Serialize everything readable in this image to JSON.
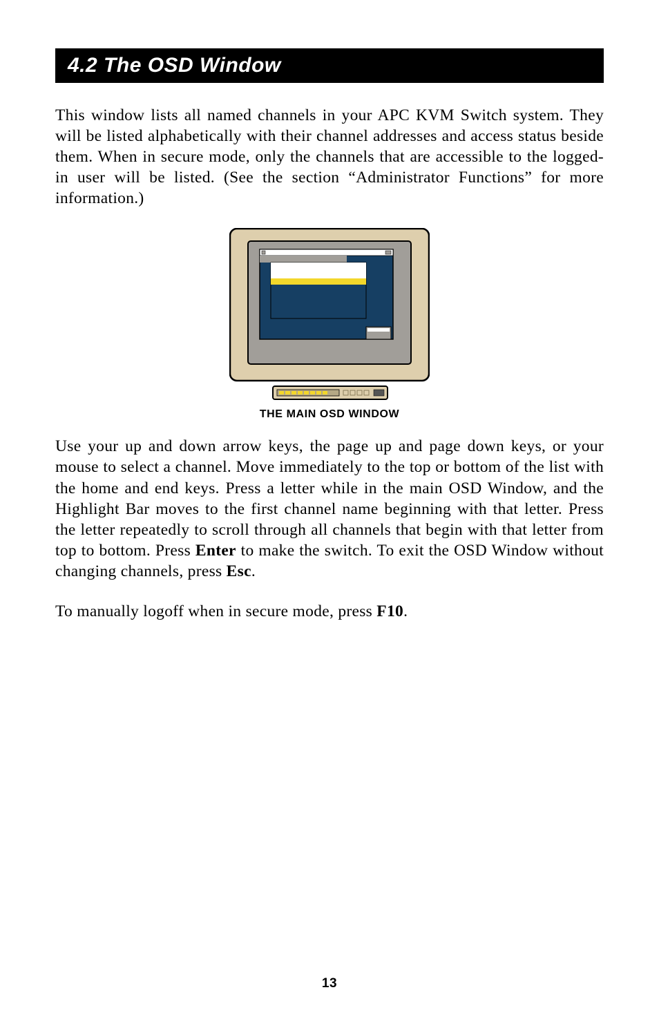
{
  "section": {
    "heading": "4.2  The OSD Window"
  },
  "paragraphs": {
    "p1": "This window lists all named channels in your APC KVM Switch system. They will be listed alphabetically with their channel addresses and access status beside them. When in secure mode, only the channels that are accessible to the logged-in user will be listed. (See the section “Administrator Functions” for more information.)",
    "p2_a": "Use your up and down arrow keys, the page up and page down keys, or your mouse to select a channel. Move immediately to the top or bottom of the list with the home and end keys. Press a letter while in the main OSD Window, and the Highlight Bar moves to the first channel name beginning with that letter. Press the letter repeatedly to scroll through all channels that begin with that letter from top to bottom. Press ",
    "p2_enter": "Enter",
    "p2_b": " to make the switch. To exit the OSD Window without changing channels, press ",
    "p2_esc": "Esc",
    "p2_c": ".",
    "p3_a": "To manually logoff when in secure mode, press ",
    "p3_f10": "F10",
    "p3_b": "."
  },
  "figure": {
    "caption": "THE MAIN OSD WINDOW",
    "colors": {
      "monitorBody": "#decfad",
      "monitorStroke": "#000000",
      "screenBezel": "#a19e99",
      "windowBg": "#163f63",
      "titlebar": "#ffffff",
      "highlightRow": "#f3d72b",
      "whiteRow": "#ffffff",
      "keyHighlight": "#f3d72b"
    }
  },
  "page_number": "13"
}
